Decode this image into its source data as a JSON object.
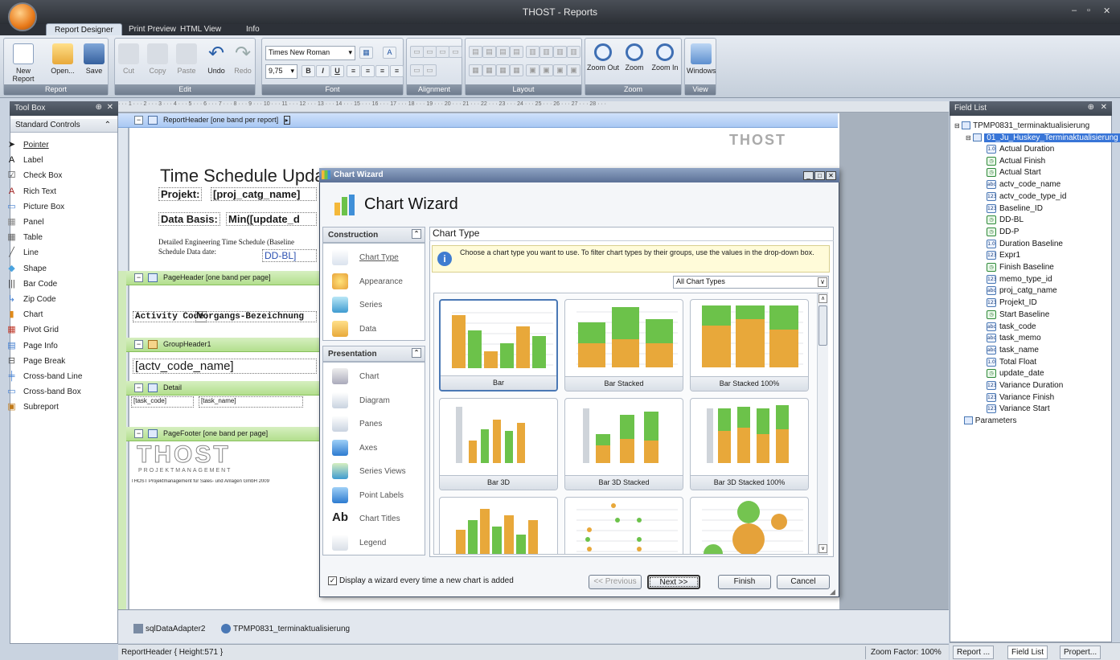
{
  "window": {
    "title": "THOST - Reports",
    "controls": [
      "–",
      "▫",
      "✕"
    ]
  },
  "tabs": [
    "Report Designer",
    "Print Preview",
    "HTML View",
    "Info"
  ],
  "ribbon": {
    "groups": [
      "Report",
      "Edit",
      "Font",
      "Alignment",
      "Layout",
      "Zoom",
      "View"
    ],
    "report": {
      "new": "New Report",
      "open": "Open...",
      "save": "Save"
    },
    "edit": {
      "cut": "Cut",
      "copy": "Copy",
      "paste": "Paste",
      "undo": "Undo",
      "redo": "Redo"
    },
    "font": {
      "name": "Times New Roman",
      "size": "9,75",
      "bold": "B",
      "italic": "I",
      "underline": "U"
    },
    "zoom": {
      "out": "Zoom Out",
      "zoom": "Zoom",
      "in": "Zoom In"
    },
    "view": {
      "windows": "Windows"
    }
  },
  "toolbox": {
    "title": "Tool Box",
    "section": "Standard Controls",
    "items": [
      {
        "label": "Pointer",
        "icon": "pointer-icon"
      },
      {
        "label": "Label",
        "icon": "label-icon"
      },
      {
        "label": "Check Box",
        "icon": "checkbox-icon"
      },
      {
        "label": "Rich Text",
        "icon": "rich-text-icon"
      },
      {
        "label": "Picture Box",
        "icon": "picture-icon"
      },
      {
        "label": "Panel",
        "icon": "panel-icon"
      },
      {
        "label": "Table",
        "icon": "table-icon"
      },
      {
        "label": "Line",
        "icon": "line-icon"
      },
      {
        "label": "Shape",
        "icon": "shape-icon"
      },
      {
        "label": "Bar Code",
        "icon": "barcode-icon"
      },
      {
        "label": "Zip Code",
        "icon": "zipcode-icon"
      },
      {
        "label": "Chart",
        "icon": "chart-icon"
      },
      {
        "label": "Pivot Grid",
        "icon": "pivot-icon"
      },
      {
        "label": "Page Info",
        "icon": "page-info-icon"
      },
      {
        "label": "Page Break",
        "icon": "page-break-icon"
      },
      {
        "label": "Cross-band Line",
        "icon": "cross-line-icon"
      },
      {
        "label": "Cross-band Box",
        "icon": "cross-box-icon"
      },
      {
        "label": "Subreport",
        "icon": "subreport-icon"
      }
    ]
  },
  "designer": {
    "bands": {
      "report_header": "ReportHeader [one band per report]",
      "page_header": "PageHeader [one band per page]",
      "group_header": "GroupHeader1",
      "detail": "Detail",
      "page_footer": "PageFooter [one band per page]"
    },
    "logo": "THOST",
    "title_text": "Time Schedule Upda",
    "projekt_label": "Projekt:",
    "projekt_field": "[proj_catg_name]",
    "data_basis_label": "Data Basis:",
    "data_basis_field": "Min([update_d",
    "detail_line1": "Detailed Engineering Time Schedule (Baseline",
    "detail_line2": "Schedule Data date:",
    "dd_bl": "DD-BL]",
    "col_activity": "Activity Code",
    "col_vorgang": "Vorgangs-Bezeichnung",
    "group_field": "[actv_code_name]",
    "task_code": "[task_code]",
    "task_name": "[task_name]",
    "footer_logo": "THOST",
    "footer_sub": "PROJEKTMANAGEMENT",
    "footer_copy": "THOST Projektmanagement für Sales- und Anlagen GmbH 2009",
    "ruler": "· · · 1 · · · 2 · · · 3 · · · 4 · · · 5 · · · 6 · · · 7 · · · 8 · · · 9 · · · 10 · · · 11 · · · 12 · · · 13 · · · 14 · · · 15 · · · 16 · · · 17 · · · 18 · · · 19 · · · 20 · · · 21 · · · 22 · · · 23 · · · 24 · · · 25 · · · 26 · · · 27 · · · 28 · · ·"
  },
  "components": [
    "sqlDataAdapter2",
    "TPMP0831_terminaktualisierung"
  ],
  "status": {
    "left": "ReportHeader { Height:571 }",
    "zoom": "Zoom Factor: 100%"
  },
  "fieldlist": {
    "title": "Field List",
    "root": "TPMP0831_terminaktualisierung",
    "table": "01_Ju_Huskey_Terminaktualisierung",
    "fields": [
      {
        "name": "Actual Duration",
        "type": "1.0"
      },
      {
        "name": "Actual Finish",
        "type": "dt"
      },
      {
        "name": "Actual Start",
        "type": "dt"
      },
      {
        "name": "actv_code_name",
        "type": "abc"
      },
      {
        "name": "actv_code_type_id",
        "type": "123"
      },
      {
        "name": "Baseline_ID",
        "type": "123"
      },
      {
        "name": "DD-BL",
        "type": "dt"
      },
      {
        "name": "DD-P",
        "type": "dt"
      },
      {
        "name": "Duration Baseline",
        "type": "1.0"
      },
      {
        "name": "Expr1",
        "type": "123"
      },
      {
        "name": "Finish Baseline",
        "type": "dt"
      },
      {
        "name": "memo_type_id",
        "type": "123"
      },
      {
        "name": "proj_catg_name",
        "type": "abc"
      },
      {
        "name": "Projekt_ID",
        "type": "123"
      },
      {
        "name": "Start Baseline",
        "type": "dt"
      },
      {
        "name": "task_code",
        "type": "abc"
      },
      {
        "name": "task_memo",
        "type": "abc"
      },
      {
        "name": "task_name",
        "type": "abc"
      },
      {
        "name": "Total Float",
        "type": "1.0"
      },
      {
        "name": "update_date",
        "type": "dt"
      },
      {
        "name": "Variance Duration",
        "type": "123"
      },
      {
        "name": "Variance Finish",
        "type": "123"
      },
      {
        "name": "Variance Start",
        "type": "123"
      }
    ],
    "parameters": "Parameters",
    "tabs": [
      "Report ...",
      "Field List",
      "Propert..."
    ]
  },
  "wizard": {
    "window_title": "Chart Wizard",
    "heading": "Chart Wizard",
    "construction": "Construction",
    "construction_items": [
      "Chart Type",
      "Appearance",
      "Series",
      "Data"
    ],
    "presentation": "Presentation",
    "presentation_items": [
      "Chart",
      "Diagram",
      "Panes",
      "Axes",
      "Series Views",
      "Point Labels",
      "Chart Titles",
      "Legend"
    ],
    "section_title": "Chart Type",
    "hint": "Choose a chart type you want to use. To filter chart types by their groups, use the values in the drop-down box.",
    "filter": "All Chart Types",
    "chart_types": [
      "Bar",
      "Bar Stacked",
      "Bar Stacked 100%",
      "Bar 3D",
      "Bar 3D Stacked",
      "Bar 3D Stacked 100%"
    ],
    "display_checkbox": "Display a wizard every time a new chart is added",
    "prev": "<< Previous",
    "next": "Next >>",
    "finish": "Finish",
    "cancel": "Cancel",
    "colors": {
      "orange": "#e8a83a",
      "green": "#6cc24a",
      "bubble_orange": "#e5a23a",
      "bubble_green": "#74c450"
    }
  }
}
